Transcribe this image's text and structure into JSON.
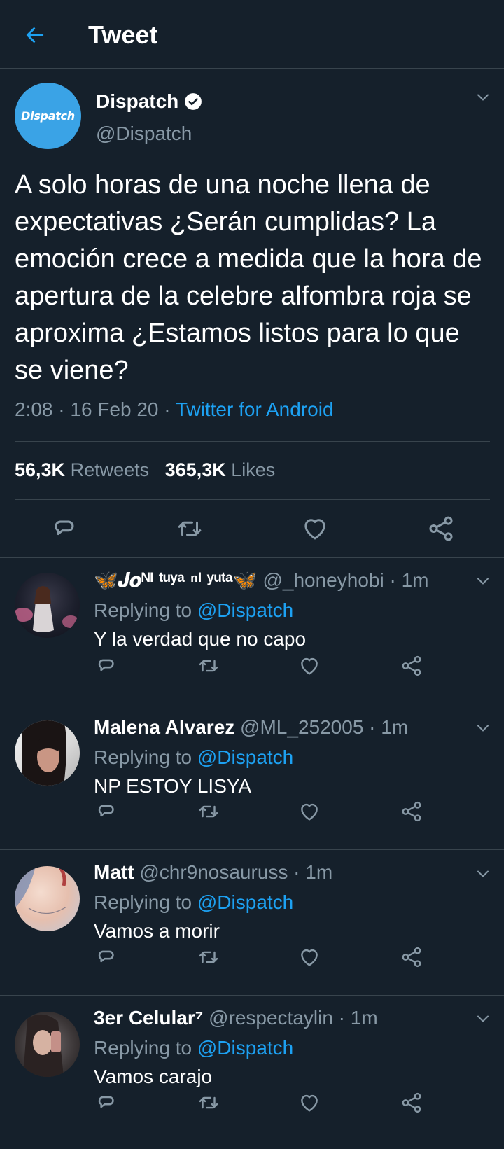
{
  "header": {
    "title": "Tweet"
  },
  "tweet": {
    "avatar_text": "Dispatch",
    "name": "Dispatch",
    "handle": "@Dispatch",
    "text": "A solo horas de una noche llena de expectativas ¿Serán cumplidas? La emoción crece a medida que la hora de apertura de la celebre alfombra roja se aproxima ¿Estamos listos para lo que se viene?",
    "time": "2:08 · 16 Feb 20 · ",
    "source": "Twitter for Android",
    "retweets_count": "56,3K",
    "retweets_label": "Retweets",
    "likes_count": "365,3K",
    "likes_label": "Likes"
  },
  "replies": [
    {
      "name": "🦋𝑱𝒐ᴺᴵ ᵗᵘʸᵃ ⁿᴵ ʸᵘᵗᵃ🦋",
      "handle": " @_honeyhobi · 1m",
      "replying_prefix": "Replying to ",
      "replying_to": "@Dispatch",
      "text": "Y la verdad que no capo"
    },
    {
      "name": "Malena Alvarez",
      "handle": " @ML_252005 · 1m",
      "replying_prefix": "Replying to ",
      "replying_to": "@Dispatch",
      "text": "NP ESTOY LISYA"
    },
    {
      "name": "Matt",
      "handle": " @chr9nosauruss · 1m",
      "replying_prefix": "Replying to ",
      "replying_to": "@Dispatch",
      "text": "Vamos a morir"
    },
    {
      "name": "3er Celular⁷",
      "handle": " @respectaylin · 1m",
      "replying_prefix": "Replying to ",
      "replying_to": "@Dispatch",
      "text": "Vamos carajo"
    }
  ],
  "icons": [
    "back-arrow-icon",
    "verified-badge-icon",
    "chevron-down-icon",
    "reply-icon",
    "retweet-icon",
    "like-icon",
    "share-icon"
  ],
  "colors": {
    "background": "#15202b",
    "accent": "#1da1f2",
    "muted": "#8899a6",
    "divider": "#38444d"
  }
}
